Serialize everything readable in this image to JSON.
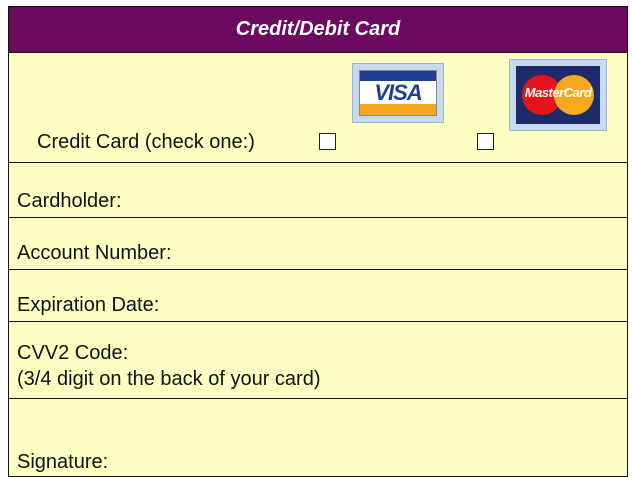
{
  "header": {
    "title": "Credit/Debit Card"
  },
  "credit_card": {
    "label": "Credit Card (check one:)",
    "visa_text": "VISA",
    "mastercard_text": "MasterCard"
  },
  "fields": {
    "cardholder": "Cardholder:",
    "account_number": "Account Number:",
    "expiration_date": "Expiration Date:",
    "cvv2_code": "CVV2 Code:",
    "cvv2_hint": "(3/4 digit on the back of your card)",
    "signature": "Signature:"
  },
  "colors": {
    "header_bg": "#6b0a5e",
    "field_bg": "#ffffc4",
    "border": "#111111"
  }
}
